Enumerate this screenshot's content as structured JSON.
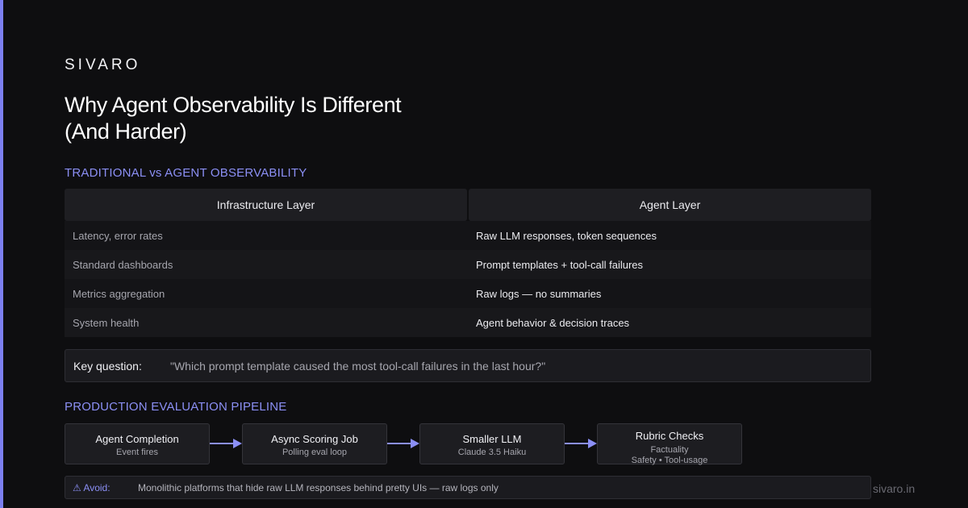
{
  "brand": "SIVARO",
  "title": {
    "line1": "Why Agent Observability Is Different",
    "line2": "(And Harder)"
  },
  "comparison": {
    "section_label": "TRADITIONAL vs AGENT OBSERVABILITY",
    "headers": [
      "Infrastructure Layer",
      "Agent Layer"
    ],
    "rows": [
      [
        "Latency, error rates",
        "Raw LLM responses, token sequences"
      ],
      [
        "Standard dashboards",
        "Prompt templates + tool-call failures"
      ],
      [
        "Metrics aggregation",
        "Raw logs — no summaries"
      ],
      [
        "System health",
        "Agent behavior & decision traces"
      ]
    ]
  },
  "key_question": {
    "label": "Key question:",
    "text": "\"Which prompt template caused the most tool-call failures in the last hour?\""
  },
  "pipeline": {
    "section_label": "PRODUCTION EVALUATION PIPELINE",
    "stages": [
      {
        "title": "Agent Completion",
        "sub": [
          "Event fires"
        ]
      },
      {
        "title": "Async Scoring Job",
        "sub": [
          "Polling eval loop"
        ]
      },
      {
        "title": "Smaller LLM",
        "sub": [
          "Claude 3.5 Haiku"
        ]
      },
      {
        "title": "Rubric Checks",
        "sub": [
          "Factuality",
          "Safety • Tool-usage"
        ]
      }
    ]
  },
  "avoid": {
    "label": "⚠ Avoid:",
    "text": "Monolithic platforms that hide raw LLM responses behind pretty UIs — raw logs only"
  },
  "footer": "sivaro.in",
  "colors": {
    "background": "#0e0e10",
    "accent": "#8b8ff5",
    "card": "#1d1d21"
  }
}
